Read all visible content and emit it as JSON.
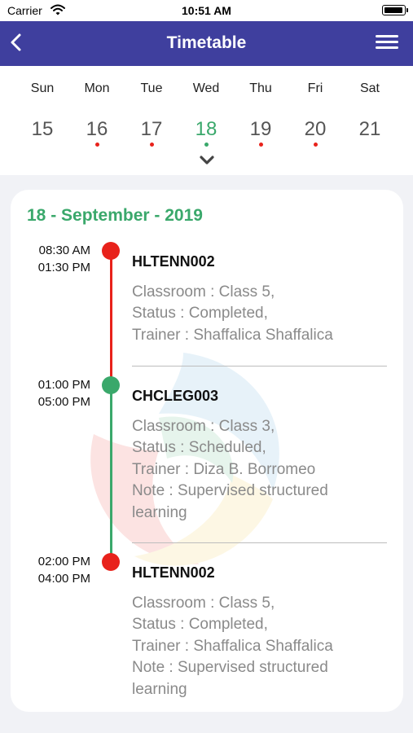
{
  "status_bar": {
    "carrier": "Carrier",
    "time": "10:51 AM"
  },
  "nav": {
    "title": "Timetable",
    "back_icon": "chevron-left-icon",
    "menu_icon": "hamburger-menu-icon"
  },
  "week": {
    "days": [
      {
        "name": "Sun",
        "date": "15",
        "dot": ""
      },
      {
        "name": "Mon",
        "date": "16",
        "dot": "#e8221b"
      },
      {
        "name": "Tue",
        "date": "17",
        "dot": "#e8221b"
      },
      {
        "name": "Wed",
        "date": "18",
        "dot": "#3aa86b",
        "selected": true
      },
      {
        "name": "Thu",
        "date": "19",
        "dot": "#e8221b"
      },
      {
        "name": "Fri",
        "date": "20",
        "dot": "#e8221b"
      },
      {
        "name": "Sat",
        "date": "21",
        "dot": ""
      }
    ],
    "expand_icon": "chevron-down-icon"
  },
  "schedule": {
    "date_heading": "18 - September - 2019",
    "events": [
      {
        "start": "08:30 AM",
        "end": "01:30 PM",
        "code": "HLTENN002",
        "color": "#e8221b",
        "details": [
          "Classroom : Class 5,",
          "Status : Completed,",
          "Trainer : Shaffalica Shaffalica"
        ]
      },
      {
        "start": "01:00 PM",
        "end": "05:00 PM",
        "code": "CHCLEG003",
        "color": "#3aa86b",
        "details": [
          "Classroom : Class 3,",
          "Status : Scheduled,",
          "Trainer : Diza B. Borromeo",
          "Note : Supervised structured",
          "learning"
        ]
      },
      {
        "start": "02:00 PM",
        "end": "04:00 PM",
        "code": "HLTENN002",
        "color": "#e8221b",
        "details": [
          "Classroom : Class 5,",
          "Status : Completed,",
          "Trainer : Shaffalica Shaffalica",
          "Note : Supervised structured",
          "learning"
        ]
      }
    ]
  },
  "colors": {
    "nav_bg": "#3f3f9e",
    "accent_green": "#3aa86b",
    "accent_red": "#e8221b"
  }
}
